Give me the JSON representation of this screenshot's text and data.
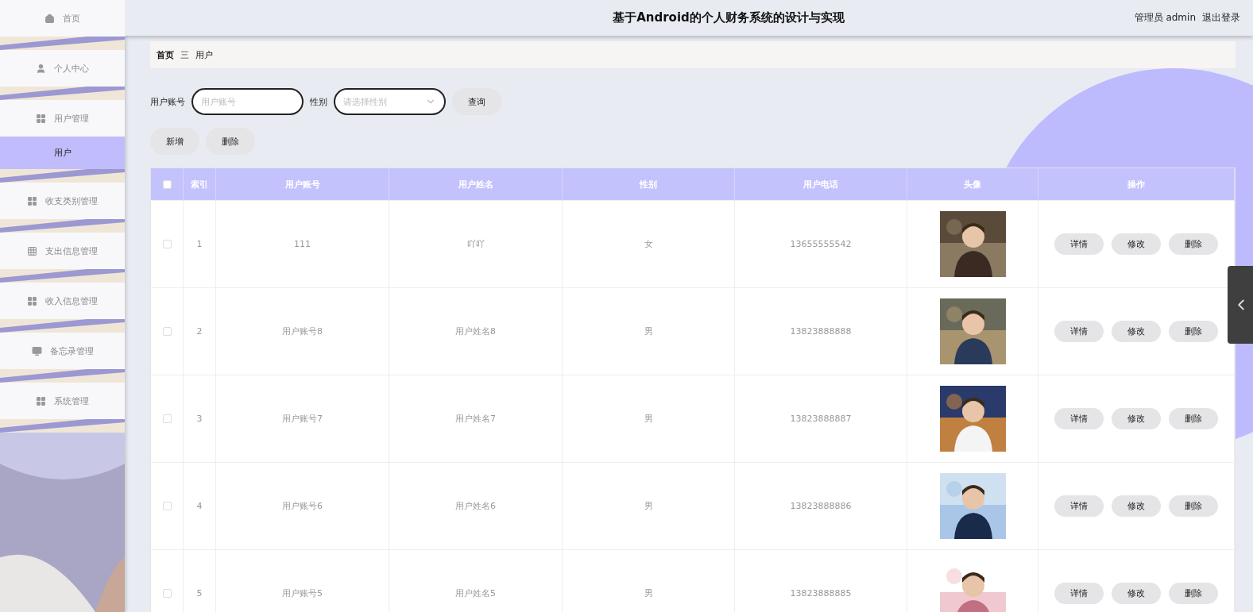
{
  "header": {
    "title": "基于Android的个人财务系统的设计与实现",
    "user": "管理员 admin",
    "logout": "退出登录"
  },
  "sidebar": {
    "items": [
      {
        "label": "首页",
        "selected": false
      },
      {
        "label": "个人中心",
        "selected": false
      },
      {
        "label": "用户管理",
        "selected": false,
        "children": [
          {
            "label": "用户",
            "selected": true
          }
        ]
      },
      {
        "label": "收支类别管理",
        "selected": false
      },
      {
        "label": "支出信息管理",
        "selected": false
      },
      {
        "label": "收入信息管理",
        "selected": false
      },
      {
        "label": "备忘录管理",
        "selected": false
      },
      {
        "label": "系统管理",
        "selected": false
      }
    ]
  },
  "breadcrumb": {
    "items": [
      "首页",
      "用户"
    ],
    "separator": "三"
  },
  "search": {
    "fields": [
      {
        "kind": "input",
        "label": "用户账号",
        "placeholder": "用户账号"
      },
      {
        "kind": "select",
        "label": "性别",
        "placeholder": "请选择性别"
      }
    ],
    "button": "查询"
  },
  "actions": [
    "新增",
    "删除"
  ],
  "table": {
    "select_all_checked": false,
    "columns": [
      "索引",
      "用户账号",
      "用户姓名",
      "性别",
      "用户电话",
      "头像",
      "操作"
    ],
    "rows": [
      {
        "checked": false,
        "index": "1",
        "account": "111",
        "name": "吖吖",
        "gender": "女",
        "phone": "13655555542",
        "actions": [
          "详情",
          "修改",
          "删除"
        ]
      },
      {
        "checked": false,
        "index": "2",
        "account": "用户账号8",
        "name": "用户姓名8",
        "gender": "男",
        "phone": "13823888888",
        "actions": [
          "详情",
          "修改",
          "删除"
        ]
      },
      {
        "checked": false,
        "index": "3",
        "account": "用户账号7",
        "name": "用户姓名7",
        "gender": "男",
        "phone": "13823888887",
        "actions": [
          "详情",
          "修改",
          "删除"
        ]
      },
      {
        "checked": false,
        "index": "4",
        "account": "用户账号6",
        "name": "用户姓名6",
        "gender": "男",
        "phone": "13823888886",
        "actions": [
          "详情",
          "修改",
          "删除"
        ]
      },
      {
        "checked": false,
        "index": "5",
        "account": "用户账号5",
        "name": "用户姓名5",
        "gender": "男",
        "phone": "13823888885",
        "actions": [
          "详情",
          "修改",
          "删除"
        ]
      }
    ]
  }
}
